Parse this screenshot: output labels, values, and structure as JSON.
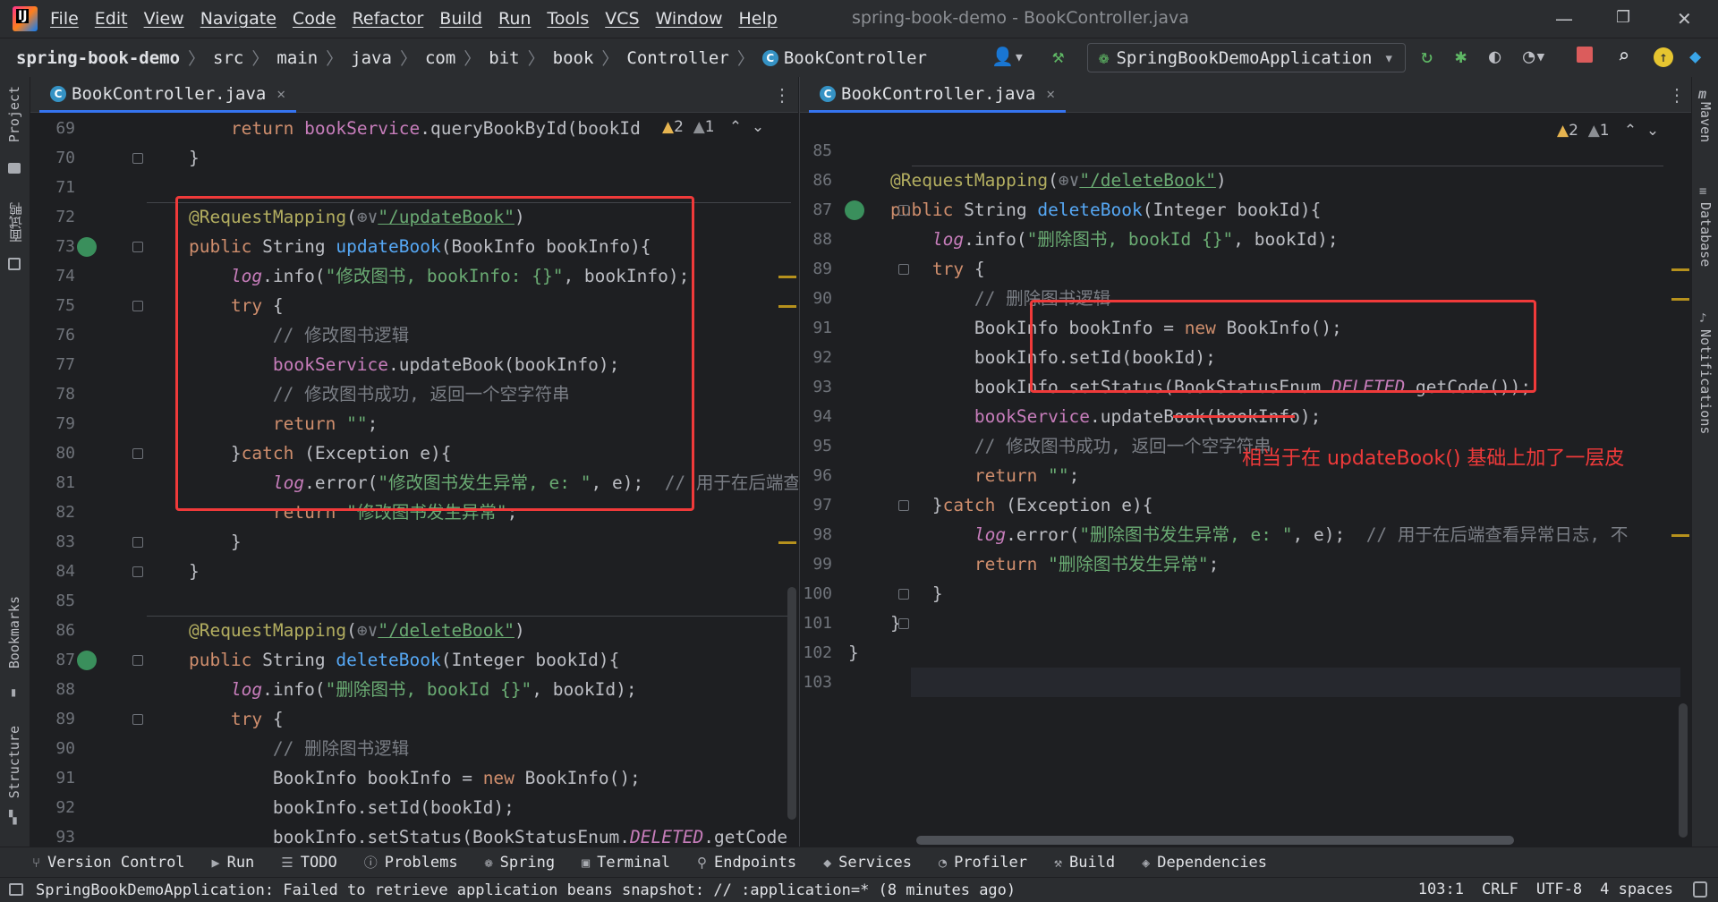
{
  "menu": [
    "File",
    "Edit",
    "View",
    "Navigate",
    "Code",
    "Refactor",
    "Build",
    "Run",
    "Tools",
    "VCS",
    "Window",
    "Help"
  ],
  "window_title": "spring-book-demo - BookController.java",
  "breadcrumb": [
    "spring-book-demo",
    "src",
    "main",
    "java",
    "com",
    "bit",
    "book",
    "Controller",
    "BookController"
  ],
  "run_config": "SpringBookDemoApplication",
  "left_tab": {
    "label": "BookController.java"
  },
  "right_tab": {
    "label": "BookController.java"
  },
  "inspections": {
    "warnings": "2",
    "weak": "1"
  },
  "side_left": [
    "Project",
    "面试鸭",
    "Bookmarks",
    "Structure"
  ],
  "side_right": [
    "Maven",
    "Database",
    "Notifications"
  ],
  "left_lines": [
    "69",
    "70",
    "71",
    "72",
    "73",
    "74",
    "75",
    "76",
    "77",
    "78",
    "79",
    "80",
    "81",
    "82",
    "83",
    "84",
    "85",
    "86",
    "87",
    "88",
    "89",
    "90",
    "91",
    "92",
    "93"
  ],
  "right_lines": [
    "85",
    "86",
    "87",
    "88",
    "89",
    "90",
    "91",
    "92",
    "93",
    "94",
    "95",
    "96",
    "97",
    "98",
    "99",
    "100",
    "101",
    "102",
    "103"
  ],
  "annotation_text": "相当于在 updateBook() 基础上加了一层皮",
  "bottom_tools": [
    "Version Control",
    "Run",
    "TODO",
    "Problems",
    "Spring",
    "Terminal",
    "Endpoints",
    "Services",
    "Profiler",
    "Build",
    "Dependencies"
  ],
  "status_message": "SpringBookDemoApplication: Failed to retrieve application beans snapshot: // :application=* (8 minutes ago)",
  "status_right": [
    "103:1",
    "CRLF",
    "UTF-8",
    "4 spaces"
  ]
}
